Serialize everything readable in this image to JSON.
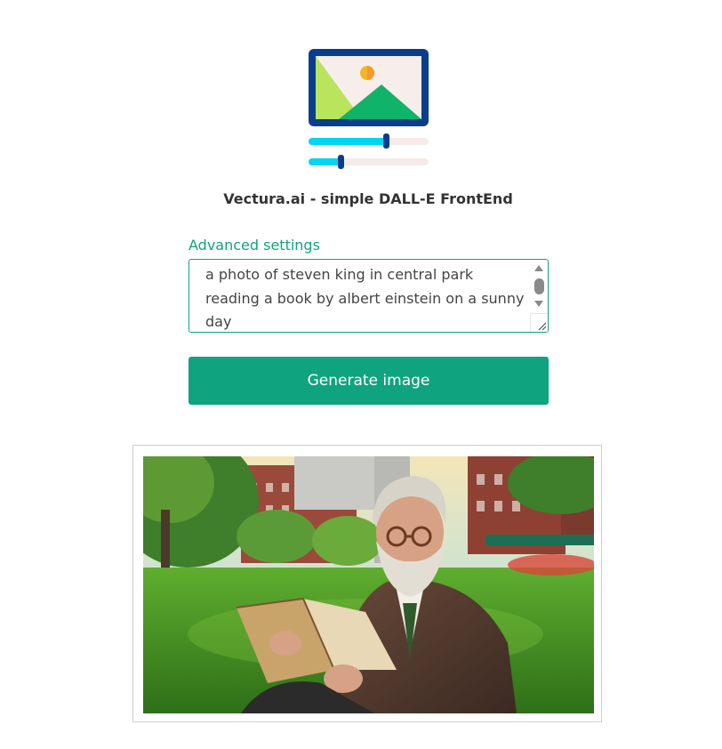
{
  "app": {
    "title": "Vectura.ai - simple DALL-E FrontEnd"
  },
  "logo": {
    "icon": "image-settings-icon",
    "colors": {
      "frame": "#0a3e8c",
      "screen": "#f7eeeb",
      "hill_light": "#b9e55c",
      "hill_dark": "#0fb36a",
      "sun": "#f5b52a",
      "slider_fill": "#00d6f0",
      "slider_track": "#f5ebe8",
      "slider_knob": "#0a3e8c"
    },
    "slider_levels": [
      0.65,
      0.27
    ]
  },
  "settings": {
    "advanced_label": "Advanced settings"
  },
  "prompt": {
    "value": "a photo of steven king in central park reading a book by albert einstein on a sunny day"
  },
  "actions": {
    "generate_label": "Generate image"
  },
  "result": {
    "alt": "generated image",
    "accent": "#10a37f"
  }
}
